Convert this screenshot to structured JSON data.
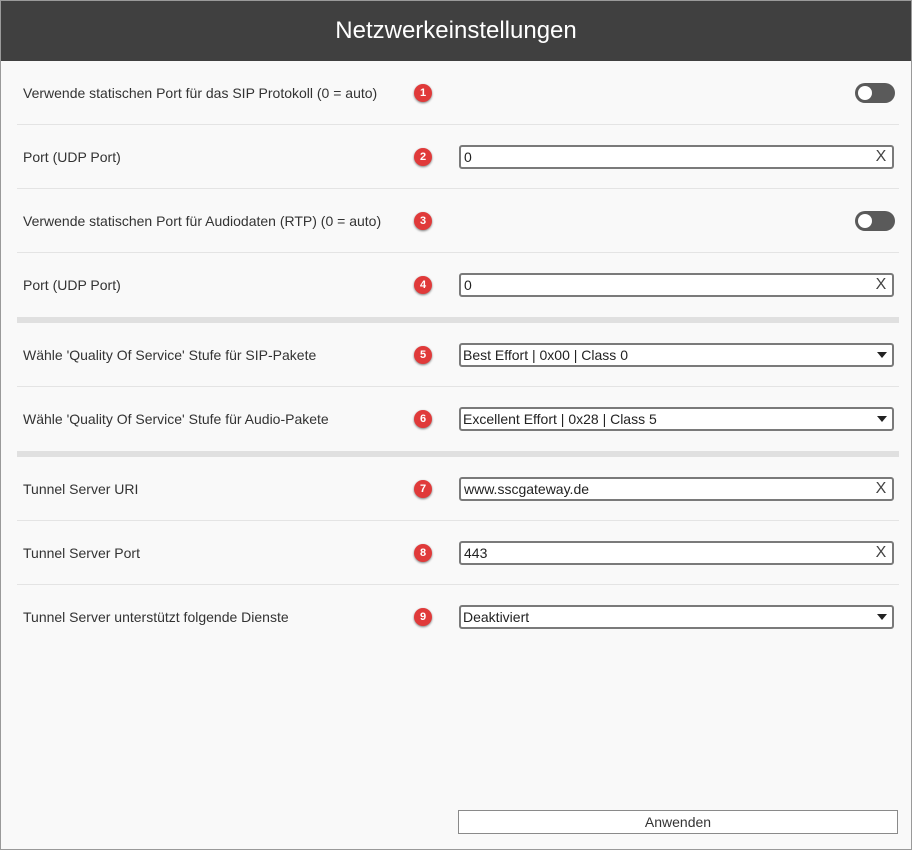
{
  "window": {
    "title": "Netzwerkeinstellungen"
  },
  "rows": [
    {
      "label": "Verwende statischen Port für das SIP Protokoll (0 = auto)",
      "badge": "1"
    },
    {
      "label": "Port (UDP Port)",
      "badge": "2",
      "value": "0",
      "clear": "X"
    },
    {
      "label": "Verwende statischen Port für Audiodaten (RTP) (0 = auto)",
      "badge": "3"
    },
    {
      "label": "Port (UDP Port)",
      "badge": "4",
      "value": "0",
      "clear": "X"
    },
    {
      "label": "Wähle 'Quality Of Service' Stufe für SIP-Pakete",
      "badge": "5",
      "selected": "Best Effort | 0x00 | Class 0"
    },
    {
      "label": "Wähle 'Quality Of Service' Stufe für Audio-Pakete",
      "badge": "6",
      "selected": "Excellent Effort | 0x28 | Class 5"
    },
    {
      "label": "Tunnel Server URI",
      "badge": "7",
      "value": "www.sscgateway.de",
      "clear": "X"
    },
    {
      "label": "Tunnel Server Port",
      "badge": "8",
      "value": "443",
      "clear": "X"
    },
    {
      "label": "Tunnel Server unterstützt folgende Dienste",
      "badge": "9",
      "selected": "Deaktiviert"
    }
  ],
  "toggles": {
    "sip_static_port": false,
    "rtp_static_port": false
  },
  "actions": {
    "apply_label": "Anwenden"
  },
  "colors": {
    "titlebar": "#404040",
    "badge": "#e03a3a",
    "toggle_off": "#5a5a5a"
  },
  "icons": {
    "clear": "clear-x-icon",
    "dropdown": "dropdown-caret-icon"
  }
}
